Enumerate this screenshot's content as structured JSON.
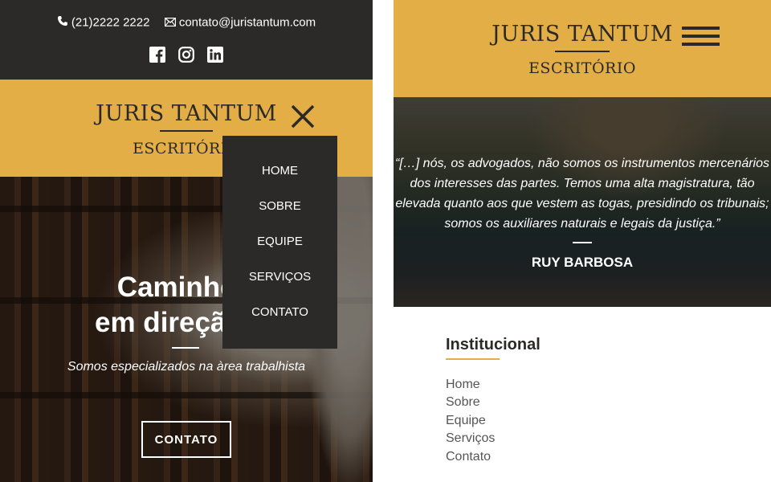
{
  "left_panel": {
    "contact": {
      "phone": "(21)2222 2222",
      "email": "contato@juristantum.com",
      "phone_icon": "phone-icon",
      "email_icon": "envelope-icon"
    },
    "social": [
      "facebook-icon",
      "instagram-icon",
      "linkedin-icon"
    ],
    "brand": {
      "title": "JURIS TANTUM",
      "subtitle": "ESCRITÓRIO"
    },
    "menu": {
      "items": [
        "HOME",
        "SOBRE",
        "EQUIPE",
        "SERVIÇOS",
        "CONTATO"
      ],
      "close_icon": "close-icon"
    },
    "hero": {
      "title_line1": "Caminhe co",
      "title_line2": "em direção à",
      "subtitle": "Somos especializados na àrea trabalhista",
      "button_label": "CONTATO"
    }
  },
  "right_panel": {
    "brand": {
      "title": "JURIS TANTUM",
      "subtitle": "ESCRITÓRIO"
    },
    "menu_icon": "hamburger-icon",
    "quote": {
      "text": "“[…] nós, os advogados, não somos os instrumentos mercenários dos interesses das partes. Temos uma alta magistratura, tão elevada quanto aos que vestem as togas, presidindo os tribunais; somos os auxiliares naturais e legais da justiça.”",
      "author": "RUY BARBOSA"
    },
    "footer": {
      "title": "Institucional",
      "links": [
        "Home",
        "Sobre",
        "Equipe",
        "Serviços",
        "Contato"
      ]
    }
  },
  "colors": {
    "gold": "#e2ae45",
    "dark": "#2b2a28",
    "white": "#ffffff",
    "link_gray": "#555555"
  }
}
